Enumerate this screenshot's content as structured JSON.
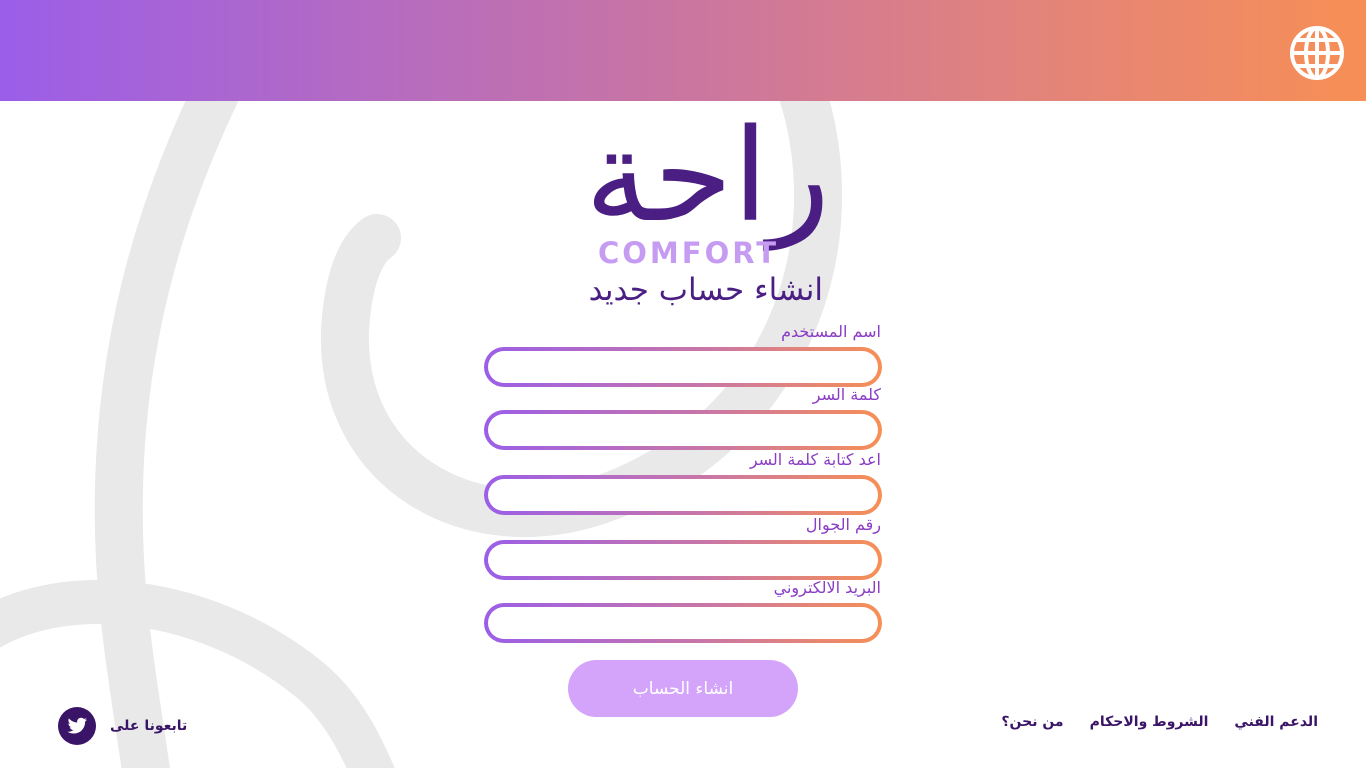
{
  "header": {
    "language_icon": "globe-icon",
    "gradient_start": "#9b5ee8",
    "gradient_end": "#f78f55"
  },
  "logo": {
    "arabic": "راحة",
    "english": "COMFORT",
    "arabic_color": "#4a1e82",
    "english_color": "#c69cf2"
  },
  "form": {
    "title": "انشاء حساب جديد",
    "fields": [
      {
        "label": "اسم المستخدم",
        "value": ""
      },
      {
        "label": "كلمة السر",
        "value": ""
      },
      {
        "label": "اعد كتابة كلمة السر",
        "value": ""
      },
      {
        "label": "رقم الجوال",
        "value": ""
      },
      {
        "label": "البريد الالكتروني",
        "value": ""
      }
    ],
    "submit_label": "انشاء الحساب",
    "submit_color": "#d4a3fa"
  },
  "footer": {
    "follow_text": "تابعونا على",
    "social_icon": "twitter-icon",
    "links": [
      {
        "label": "الدعم الفني"
      },
      {
        "label": "الشروط والاحكام"
      },
      {
        "label": "من نحن؟"
      }
    ]
  }
}
